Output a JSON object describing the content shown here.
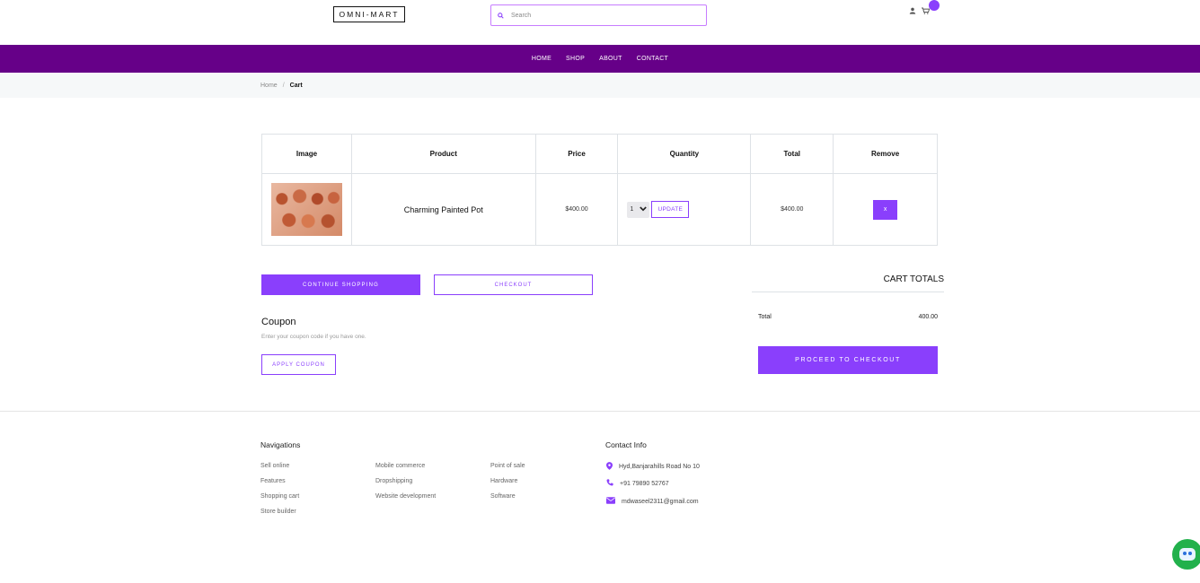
{
  "header": {
    "logo": "OMNI-MART",
    "search_placeholder": "Search",
    "icons": [
      "user-icon",
      "cart-icon"
    ]
  },
  "nav": {
    "items": [
      "HOME",
      "SHOP",
      "ABOUT",
      "CONTACT"
    ]
  },
  "breadcrumb": {
    "home": "Home",
    "separator": "/",
    "current": "Cart"
  },
  "cart_table": {
    "headers": [
      "Image",
      "Product",
      "Price",
      "Quantity",
      "Total",
      "Remove"
    ],
    "rows": [
      {
        "product": "Charming Painted Pot",
        "price": "$400.00",
        "quantity": "1",
        "update_label": "UPDATE",
        "total": "$400.00",
        "remove_label": "x"
      }
    ]
  },
  "actions": {
    "continue": "CONTINUE SHOPPING",
    "checkout": "CHECKOUT"
  },
  "coupon": {
    "title": "Coupon",
    "description": "Enter your coupon code if you have one.",
    "apply_label": "APPLY COUPON"
  },
  "totals": {
    "title": "CART TOTALS",
    "label": "Total",
    "value": "400.00",
    "proceed": "PROCEED TO CHECKOUT"
  },
  "footer": {
    "nav_heading": "Navigations",
    "col1": [
      "Sell online",
      "Features",
      "Shopping cart",
      "Store builder"
    ],
    "col2": [
      "Mobile commerce",
      "Dropshipping",
      "Website development"
    ],
    "col3": [
      "Point of sale",
      "Hardware",
      "Software"
    ],
    "contact_heading": "Contact Info",
    "address": "Hyd,Banjarahills Road No 10",
    "phone": "+91 79890 52767",
    "email": "mdwaseel2311@gmail.com"
  },
  "colors": {
    "accent": "#8a3ffc",
    "nav_bg": "#660088"
  }
}
